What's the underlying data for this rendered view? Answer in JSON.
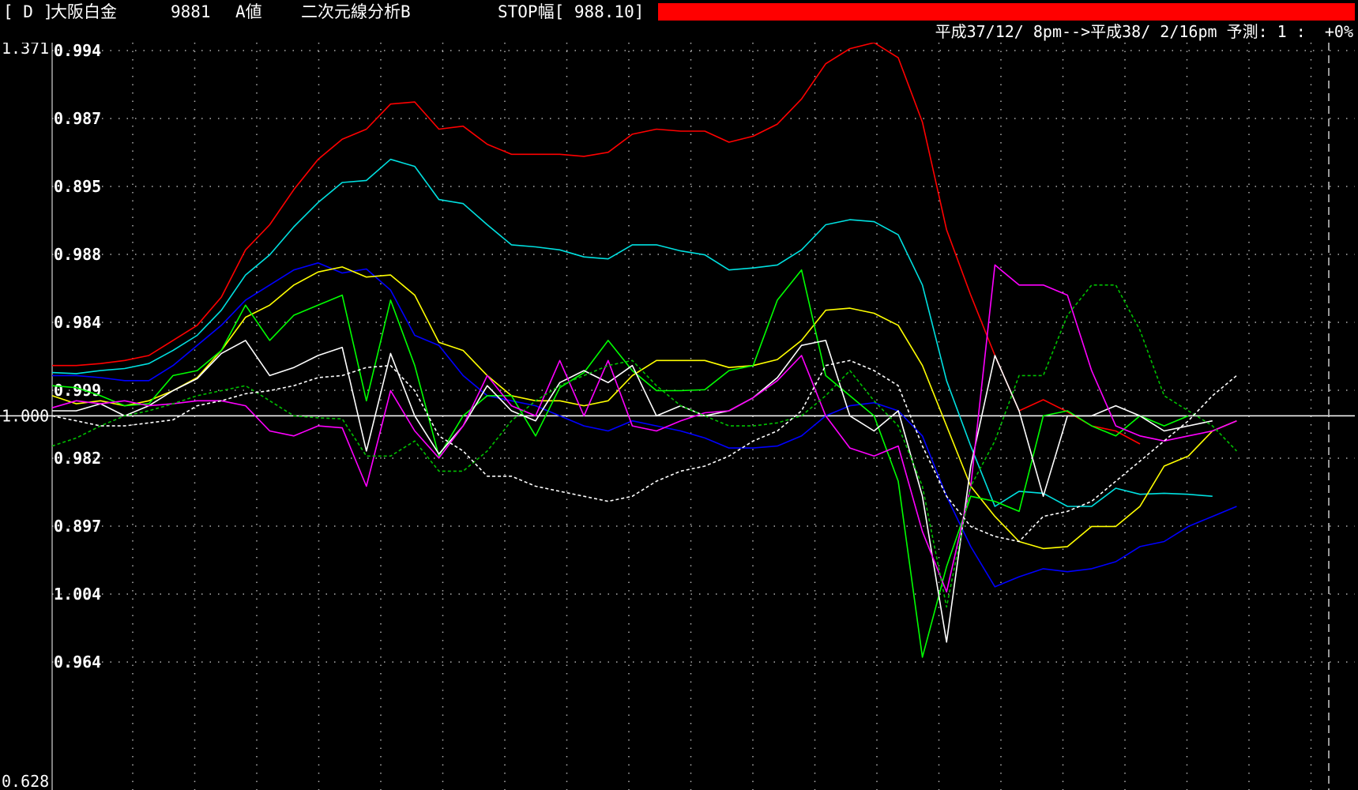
{
  "header": {
    "code_tag": "[ D ]",
    "name": "大阪白金",
    "number": "9881",
    "value_type": "A値",
    "analysis": "二次元線分析B",
    "stop": "STOP幅[ 988.10]",
    "period": "平成37/12/ 8pm-->平成38/ 2/16pm 予測: 1 :  +0%"
  },
  "colors": {
    "background": "#000000",
    "grid": "#b0b0b0",
    "stop_bar": "#ff0000",
    "baseline": "#ffffff"
  },
  "chart_data": {
    "type": "line",
    "left_axis": {
      "top": "1.371",
      "mid": "1.000",
      "bottom": "0.628"
    },
    "y_tick_labels": [
      "0.994",
      "0.987",
      "0.895",
      "0.988",
      "0.984",
      "0.999",
      "0.982",
      "0.897",
      "1.004",
      "0.964"
    ],
    "ylim": [
      0.628,
      1.371
    ],
    "baseline": 1.0,
    "series": [
      {
        "color": "#ff0000",
        "style": "solid",
        "values": [
          1.05,
          1.05,
          1.052,
          1.055,
          1.06,
          1.075,
          1.09,
          1.118,
          1.165,
          1.19,
          1.225,
          1.255,
          1.275,
          1.285,
          1.31,
          1.312,
          1.285,
          1.288,
          1.27,
          1.26,
          1.26,
          1.26,
          1.258,
          1.262,
          1.28,
          1.285,
          1.283,
          1.283,
          1.272,
          1.278,
          1.29,
          1.315,
          1.35,
          1.365,
          1.371,
          1.356,
          1.292,
          1.185,
          1.12,
          1.06,
          1.005,
          1.016,
          1.004,
          0.99,
          0.985,
          0.972
        ]
      },
      {
        "color": "#00e0e0",
        "style": "solid",
        "values": [
          1.043,
          1.042,
          1.045,
          1.047,
          1.052,
          1.065,
          1.08,
          1.105,
          1.14,
          1.16,
          1.188,
          1.212,
          1.232,
          1.234,
          1.255,
          1.248,
          1.215,
          1.211,
          1.19,
          1.17,
          1.168,
          1.165,
          1.158,
          1.156,
          1.17,
          1.17,
          1.164,
          1.16,
          1.145,
          1.147,
          1.15,
          1.165,
          1.19,
          1.195,
          1.193,
          1.18,
          1.13,
          1.035,
          0.97,
          0.91,
          0.925,
          0.923,
          0.91,
          0.91,
          0.928,
          0.922,
          0.923,
          0.922,
          0.92
        ]
      },
      {
        "color": "#0000ff",
        "style": "solid",
        "values": [
          1.04,
          1.04,
          1.038,
          1.035,
          1.035,
          1.05,
          1.07,
          1.09,
          1.115,
          1.13,
          1.145,
          1.152,
          1.142,
          1.146,
          1.125,
          1.08,
          1.07,
          1.04,
          1.02,
          1.015,
          1.01,
          1.0,
          0.99,
          0.985,
          0.995,
          0.99,
          0.985,
          0.978,
          0.968,
          0.968,
          0.97,
          0.98,
          1.0,
          1.01,
          1.013,
          1.005,
          0.98,
          0.92,
          0.87,
          0.83,
          0.84,
          0.848,
          0.845,
          0.848,
          0.855,
          0.87,
          0.875,
          0.89,
          0.9,
          0.91
        ]
      },
      {
        "color": "#ffff00",
        "style": "solid",
        "values": [
          1.02,
          1.012,
          1.015,
          1.01,
          1.015,
          1.025,
          1.038,
          1.065,
          1.098,
          1.11,
          1.13,
          1.143,
          1.148,
          1.138,
          1.14,
          1.12,
          1.073,
          1.065,
          1.04,
          1.02,
          1.015,
          1.015,
          1.01,
          1.015,
          1.04,
          1.055,
          1.055,
          1.055,
          1.048,
          1.05,
          1.056,
          1.075,
          1.105,
          1.107,
          1.102,
          1.09,
          1.05,
          0.99,
          0.93,
          0.9,
          0.875,
          0.868,
          0.87,
          0.89,
          0.89,
          0.91,
          0.95,
          0.96,
          0.985,
          0.995
        ]
      },
      {
        "color": "#00ff00",
        "style": "solid",
        "values": [
          1.03,
          1.028,
          1.02,
          1.01,
          1.012,
          1.04,
          1.045,
          1.065,
          1.11,
          1.075,
          1.1,
          1.11,
          1.12,
          1.015,
          1.115,
          1.05,
          0.96,
          1.0,
          1.02,
          1.02,
          0.98,
          1.028,
          1.043,
          1.075,
          1.045,
          1.025,
          1.025,
          1.026,
          1.045,
          1.05,
          1.115,
          1.145,
          1.04,
          1.02,
          1.0,
          0.935,
          0.76,
          0.85,
          0.92,
          0.915,
          0.905,
          1.0,
          1.005,
          0.99,
          0.98,
          1.0,
          0.99,
          1.0
        ]
      },
      {
        "color": "#ffffff",
        "style": "solid",
        "values": [
          1.005,
          1.005,
          1.012,
          1.0,
          1.01,
          1.025,
          1.037,
          1.062,
          1.075,
          1.04,
          1.048,
          1.06,
          1.068,
          0.965,
          1.062,
          1.0,
          0.962,
          0.99,
          1.03,
          1.005,
          0.995,
          1.033,
          1.045,
          1.033,
          1.05,
          1.0,
          1.01,
          1.0,
          1.005,
          1.018,
          1.038,
          1.07,
          1.075,
          1.0,
          0.985,
          1.005,
          0.92,
          0.775,
          0.95,
          1.06,
          1.005,
          0.92,
          1.0,
          1.0,
          1.01,
          1.0,
          0.985,
          0.99,
          0.995
        ]
      },
      {
        "color": "#ff00ff",
        "style": "solid",
        "values": [
          1.008,
          1.015,
          1.012,
          1.015,
          1.01,
          1.012,
          1.015,
          1.015,
          1.01,
          0.985,
          0.98,
          0.99,
          0.988,
          0.93,
          1.025,
          0.985,
          0.958,
          0.99,
          1.04,
          1.01,
          1.0,
          1.055,
          1.0,
          1.055,
          0.99,
          0.985,
          0.995,
          1.003,
          1.005,
          1.018,
          1.035,
          1.06,
          1.0,
          0.968,
          0.96,
          0.97,
          0.885,
          0.825,
          0.93,
          1.15,
          1.13,
          1.13,
          1.12,
          1.045,
          0.99,
          0.98,
          0.975,
          0.98,
          0.985,
          0.995
        ]
      },
      {
        "color": "#00c000",
        "style": "dashed",
        "values": [
          0.97,
          0.978,
          0.99,
          1.0,
          1.005,
          1.012,
          1.02,
          1.025,
          1.03,
          1.015,
          1.0,
          0.998,
          0.997,
          0.96,
          0.96,
          0.975,
          0.945,
          0.945,
          0.965,
          0.995,
          1.015,
          1.03,
          1.04,
          1.05,
          1.055,
          1.03,
          1.01,
          1.0,
          0.99,
          0.99,
          0.993,
          1.0,
          1.02,
          1.045,
          1.015,
          0.99,
          0.93,
          0.81,
          0.93,
          0.975,
          1.04,
          1.04,
          1.1,
          1.13,
          1.13,
          1.085,
          1.02,
          1.005,
          0.99,
          0.965
        ]
      },
      {
        "color": "#ffffff",
        "style": "dashed",
        "values": [
          1.0,
          0.995,
          0.99,
          0.99,
          0.993,
          0.996,
          1.01,
          1.015,
          1.022,
          1.025,
          1.03,
          1.038,
          1.04,
          1.048,
          1.05,
          1.025,
          0.98,
          0.965,
          0.94,
          0.94,
          0.93,
          0.925,
          0.92,
          0.915,
          0.92,
          0.935,
          0.945,
          0.95,
          0.96,
          0.975,
          0.985,
          1.005,
          1.05,
          1.055,
          1.045,
          1.03,
          0.97,
          0.92,
          0.89,
          0.88,
          0.875,
          0.9,
          0.905,
          0.915,
          0.935,
          0.955,
          0.975,
          0.995,
          1.02,
          1.04
        ]
      }
    ]
  }
}
